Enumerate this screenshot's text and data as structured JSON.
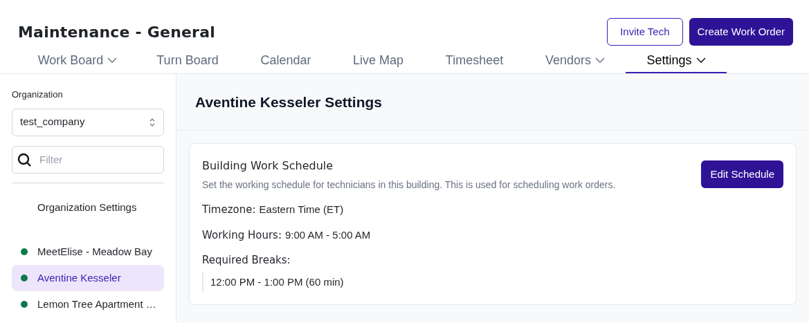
{
  "header": {
    "title": "Maintenance - General",
    "buttons": [
      {
        "label": "Invite Tech",
        "kind": "outline"
      },
      {
        "label": "Create Work Order",
        "kind": "primary"
      }
    ]
  },
  "tabs": [
    {
      "label": "Work Board",
      "dropdown": true,
      "selected": false
    },
    {
      "label": "Turn Board",
      "dropdown": false,
      "selected": false
    },
    {
      "label": "Calendar",
      "dropdown": false,
      "selected": false
    },
    {
      "label": "Live Map",
      "dropdown": false,
      "selected": false
    },
    {
      "label": "Timesheet",
      "dropdown": false,
      "selected": false
    },
    {
      "label": "Vendors",
      "dropdown": true,
      "selected": false
    },
    {
      "label": "Settings",
      "dropdown": true,
      "selected": true
    }
  ],
  "sidebar": {
    "organization_label": "Organization",
    "organization_value": "test_company",
    "filter": {
      "placeholder": "Filter"
    },
    "organization_settings": "Organization Settings",
    "buildings": [
      {
        "name": "MeetElise - Meadow Bay",
        "color": "#0b7a4b",
        "selected": false
      },
      {
        "name": "Aventine Kesseler",
        "color": "#0b7a4b",
        "selected": true
      },
      {
        "name": "Lemon Tree Apartment …",
        "color": "#0b7a4b",
        "selected": false
      }
    ]
  },
  "main": {
    "title": "Aventine Kesseler Settings",
    "card": {
      "title": "Building Work Schedule",
      "description": "Set the working schedule for technicians in this building. This is used for scheduling work orders.",
      "button": "Edit Schedule",
      "fields": [
        {
          "label": "Timezone:",
          "value": "Eastern Time (ET)"
        },
        {
          "label": "Working Hours:",
          "value": "9:00 AM - 5:00 AM"
        }
      ],
      "breaks_label": "Required Breaks:",
      "breaks": [
        "12:00 PM - 1:00 PM (60 min)"
      ]
    }
  }
}
